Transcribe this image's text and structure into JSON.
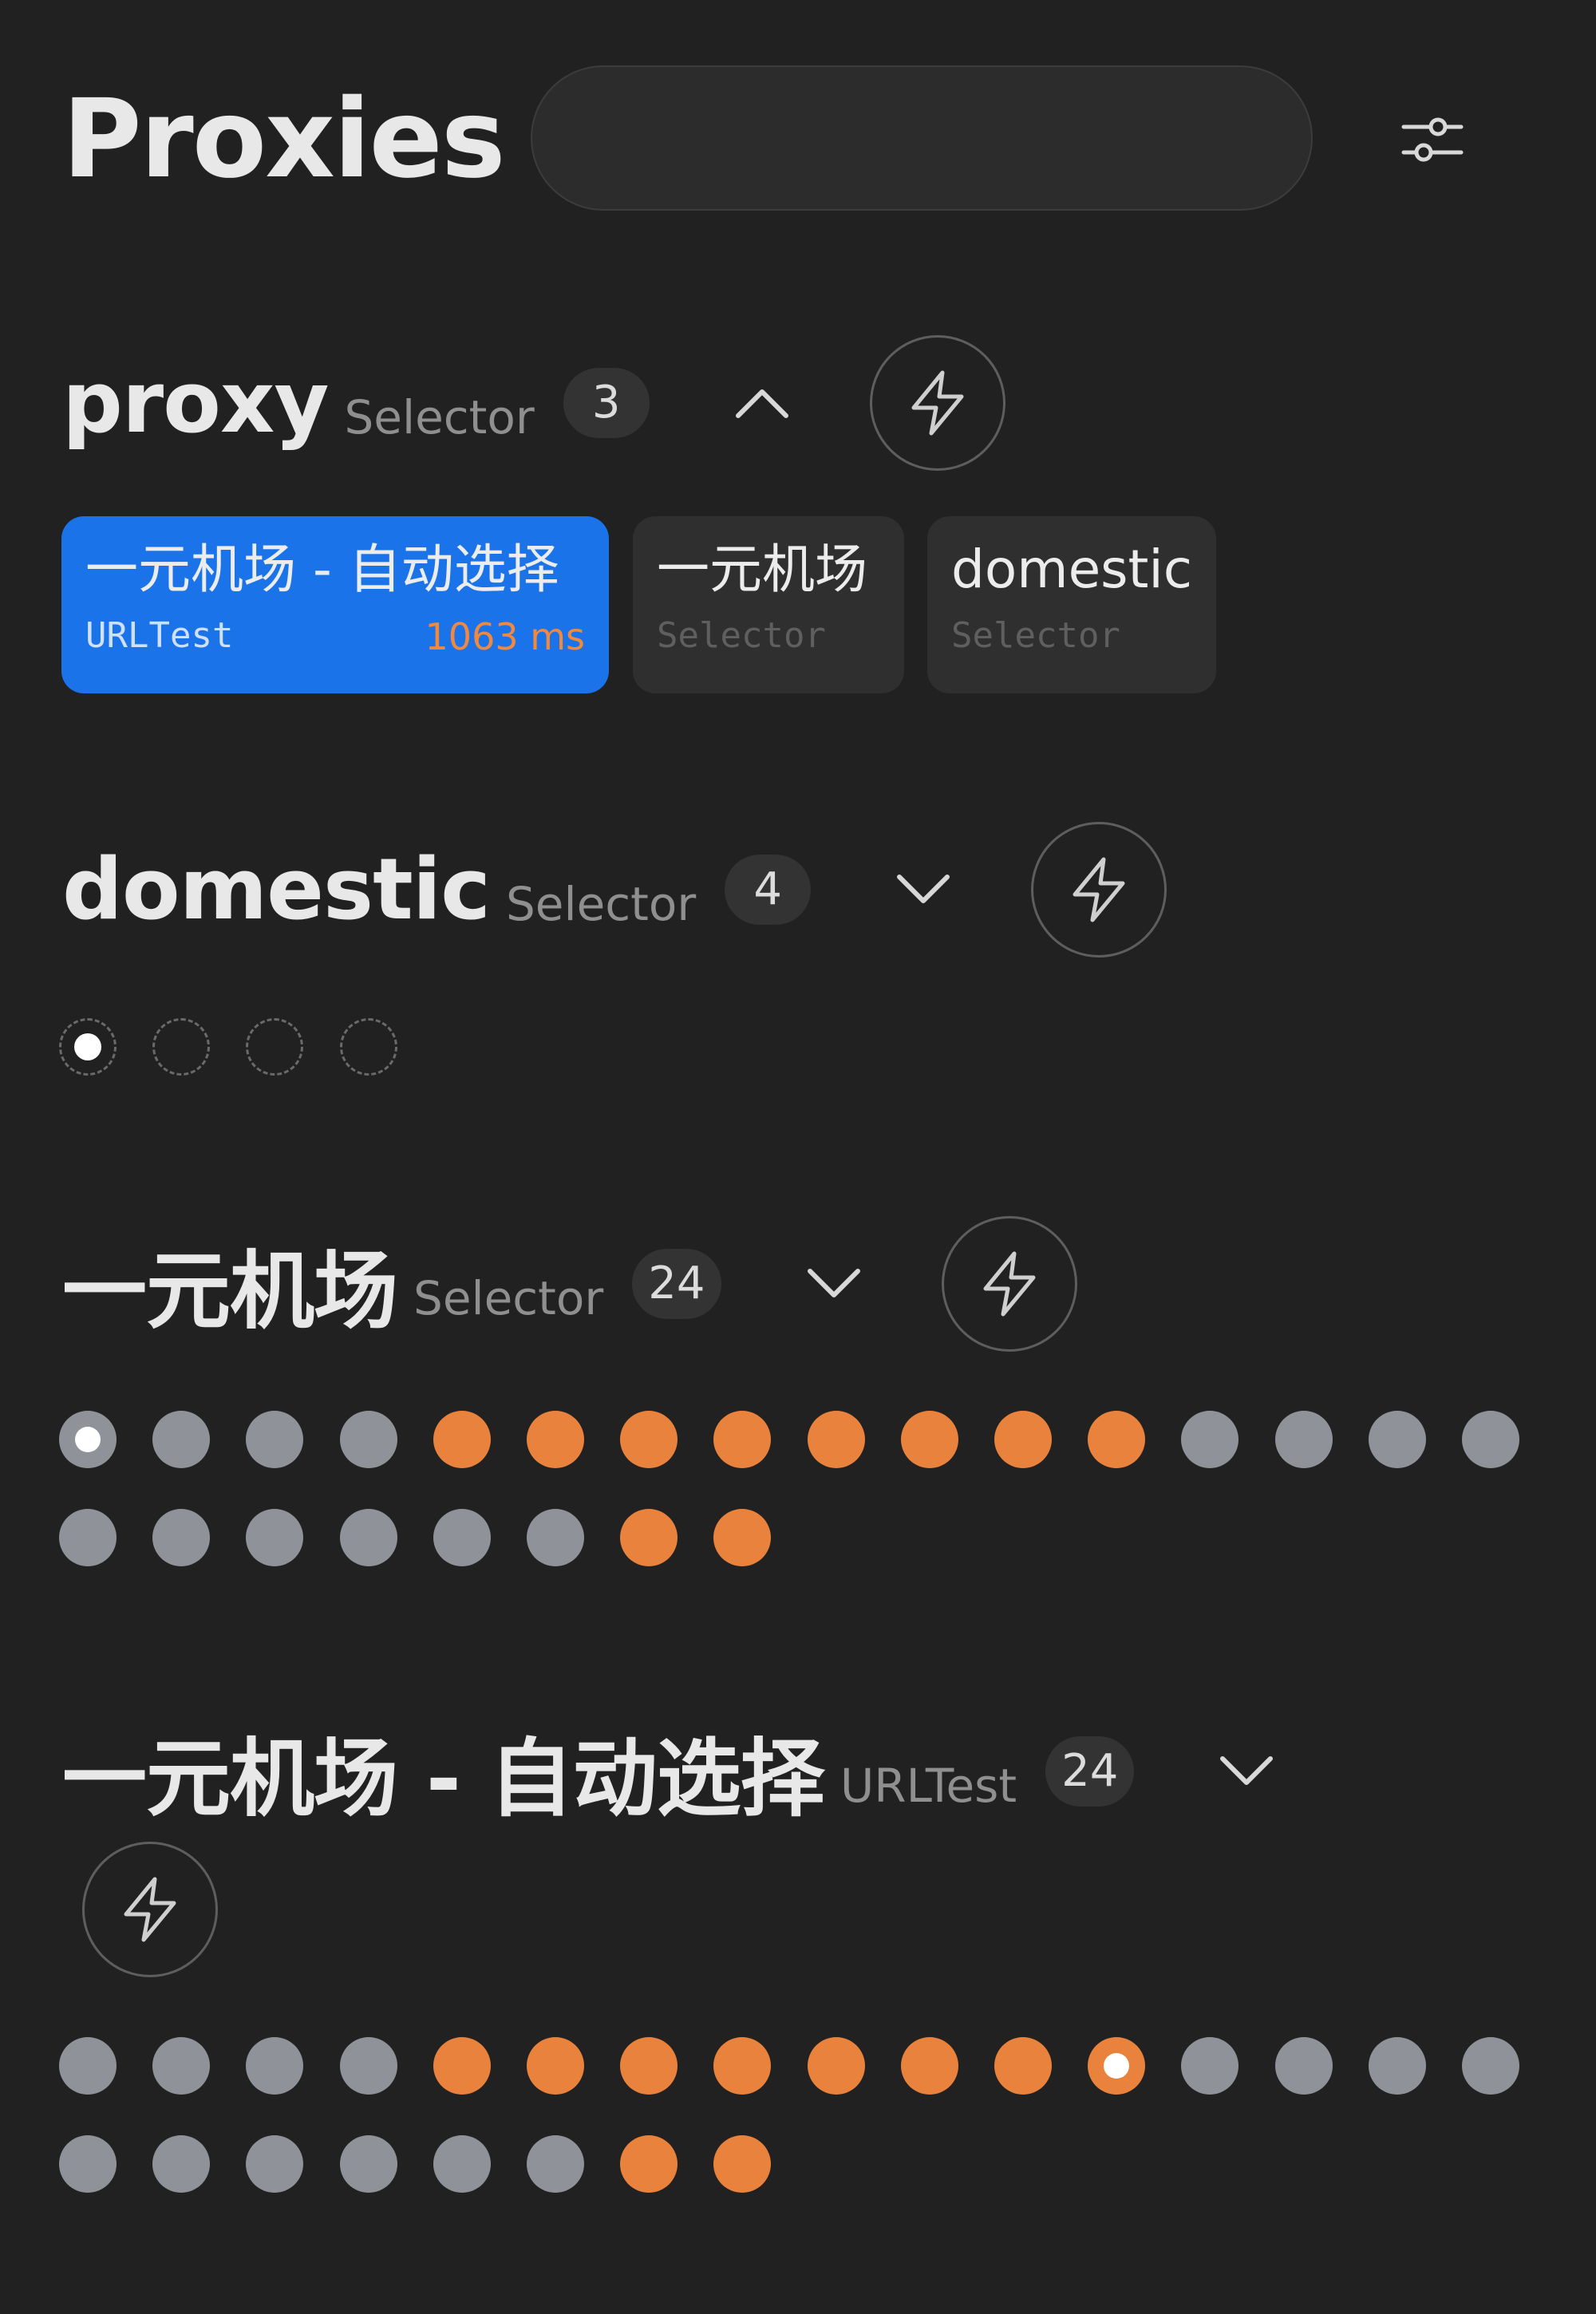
{
  "header": {
    "title": "Proxies",
    "search_placeholder": "",
    "settings_icon": "sliders-icon"
  },
  "groups": [
    {
      "name": "proxy",
      "type": "Selector",
      "count": "3",
      "expanded": true,
      "chevron_icon": "chevron-up-icon",
      "test_icon": "lightning-bolt-icon",
      "proxies": [
        {
          "name": "一元机场 - 自动选择",
          "type": "URLTest",
          "delay": "1063 ms",
          "selected": true
        },
        {
          "name": "一元机场",
          "type": "Selector",
          "delay": "",
          "selected": false
        },
        {
          "name": "domestic",
          "type": "Selector",
          "delay": "",
          "selected": false
        }
      ]
    },
    {
      "name": "domestic",
      "type": "Selector",
      "count": "4",
      "expanded": false,
      "chevron_icon": "chevron-down-icon",
      "test_icon": "lightning-bolt-icon",
      "dots": [
        "empty",
        "empty",
        "empty",
        "empty"
      ],
      "selected_index": 0
    },
    {
      "name": "一元机场",
      "type": "Selector",
      "count": "24",
      "expanded": false,
      "chevron_icon": "chevron-down-icon",
      "test_icon": "lightning-bolt-icon",
      "dots": [
        "gray",
        "gray",
        "gray",
        "gray",
        "orange",
        "orange",
        "orange",
        "orange",
        "orange",
        "orange",
        "orange",
        "orange",
        "gray",
        "gray",
        "gray",
        "gray",
        "gray",
        "gray",
        "gray",
        "gray",
        "gray",
        "gray",
        "orange",
        "orange"
      ],
      "selected_index": 0
    },
    {
      "name": "一元机场 - 自动选择",
      "type": "URLTest",
      "count": "24",
      "expanded": false,
      "chevron_icon": "chevron-down-icon",
      "test_icon": "lightning-bolt-icon",
      "dots": [
        "gray",
        "gray",
        "gray",
        "gray",
        "orange",
        "orange",
        "orange",
        "orange",
        "orange",
        "orange",
        "orange",
        "orange",
        "gray",
        "gray",
        "gray",
        "gray",
        "gray",
        "gray",
        "gray",
        "gray",
        "gray",
        "gray",
        "orange",
        "orange"
      ],
      "selected_index": 11
    }
  ],
  "colors": {
    "background": "#212121",
    "active_card": "#1a73e8",
    "delay_high": "#e8823c",
    "delay_unknown": "#8f9399"
  }
}
